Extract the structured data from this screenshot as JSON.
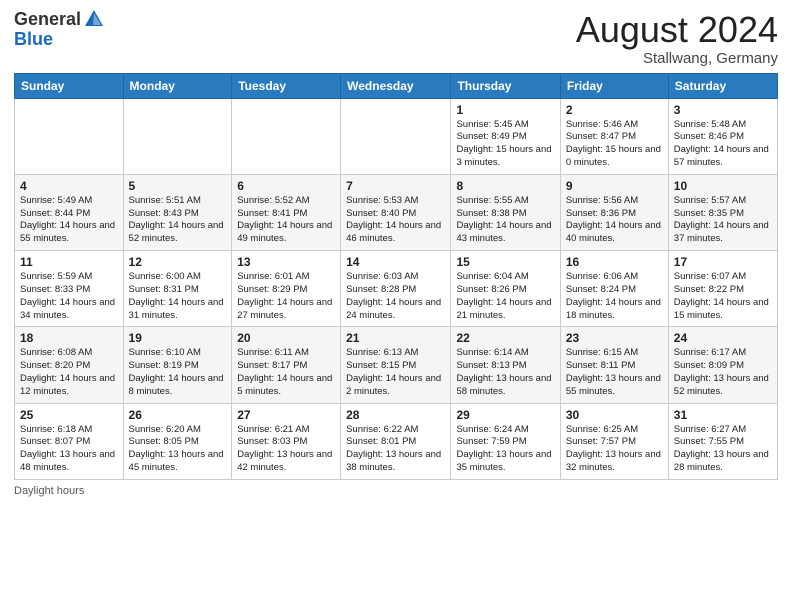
{
  "header": {
    "logo_general": "General",
    "logo_blue": "Blue",
    "month_year": "August 2024",
    "location": "Stallwang, Germany"
  },
  "days_of_week": [
    "Sunday",
    "Monday",
    "Tuesday",
    "Wednesday",
    "Thursday",
    "Friday",
    "Saturday"
  ],
  "weeks": [
    [
      {
        "day": "",
        "info": ""
      },
      {
        "day": "",
        "info": ""
      },
      {
        "day": "",
        "info": ""
      },
      {
        "day": "",
        "info": ""
      },
      {
        "day": "1",
        "info": "Sunrise: 5:45 AM\nSunset: 8:49 PM\nDaylight: 15 hours and 3 minutes."
      },
      {
        "day": "2",
        "info": "Sunrise: 5:46 AM\nSunset: 8:47 PM\nDaylight: 15 hours and 0 minutes."
      },
      {
        "day": "3",
        "info": "Sunrise: 5:48 AM\nSunset: 8:46 PM\nDaylight: 14 hours and 57 minutes."
      }
    ],
    [
      {
        "day": "4",
        "info": "Sunrise: 5:49 AM\nSunset: 8:44 PM\nDaylight: 14 hours and 55 minutes."
      },
      {
        "day": "5",
        "info": "Sunrise: 5:51 AM\nSunset: 8:43 PM\nDaylight: 14 hours and 52 minutes."
      },
      {
        "day": "6",
        "info": "Sunrise: 5:52 AM\nSunset: 8:41 PM\nDaylight: 14 hours and 49 minutes."
      },
      {
        "day": "7",
        "info": "Sunrise: 5:53 AM\nSunset: 8:40 PM\nDaylight: 14 hours and 46 minutes."
      },
      {
        "day": "8",
        "info": "Sunrise: 5:55 AM\nSunset: 8:38 PM\nDaylight: 14 hours and 43 minutes."
      },
      {
        "day": "9",
        "info": "Sunrise: 5:56 AM\nSunset: 8:36 PM\nDaylight: 14 hours and 40 minutes."
      },
      {
        "day": "10",
        "info": "Sunrise: 5:57 AM\nSunset: 8:35 PM\nDaylight: 14 hours and 37 minutes."
      }
    ],
    [
      {
        "day": "11",
        "info": "Sunrise: 5:59 AM\nSunset: 8:33 PM\nDaylight: 14 hours and 34 minutes."
      },
      {
        "day": "12",
        "info": "Sunrise: 6:00 AM\nSunset: 8:31 PM\nDaylight: 14 hours and 31 minutes."
      },
      {
        "day": "13",
        "info": "Sunrise: 6:01 AM\nSunset: 8:29 PM\nDaylight: 14 hours and 27 minutes."
      },
      {
        "day": "14",
        "info": "Sunrise: 6:03 AM\nSunset: 8:28 PM\nDaylight: 14 hours and 24 minutes."
      },
      {
        "day": "15",
        "info": "Sunrise: 6:04 AM\nSunset: 8:26 PM\nDaylight: 14 hours and 21 minutes."
      },
      {
        "day": "16",
        "info": "Sunrise: 6:06 AM\nSunset: 8:24 PM\nDaylight: 14 hours and 18 minutes."
      },
      {
        "day": "17",
        "info": "Sunrise: 6:07 AM\nSunset: 8:22 PM\nDaylight: 14 hours and 15 minutes."
      }
    ],
    [
      {
        "day": "18",
        "info": "Sunrise: 6:08 AM\nSunset: 8:20 PM\nDaylight: 14 hours and 12 minutes."
      },
      {
        "day": "19",
        "info": "Sunrise: 6:10 AM\nSunset: 8:19 PM\nDaylight: 14 hours and 8 minutes."
      },
      {
        "day": "20",
        "info": "Sunrise: 6:11 AM\nSunset: 8:17 PM\nDaylight: 14 hours and 5 minutes."
      },
      {
        "day": "21",
        "info": "Sunrise: 6:13 AM\nSunset: 8:15 PM\nDaylight: 14 hours and 2 minutes."
      },
      {
        "day": "22",
        "info": "Sunrise: 6:14 AM\nSunset: 8:13 PM\nDaylight: 13 hours and 58 minutes."
      },
      {
        "day": "23",
        "info": "Sunrise: 6:15 AM\nSunset: 8:11 PM\nDaylight: 13 hours and 55 minutes."
      },
      {
        "day": "24",
        "info": "Sunrise: 6:17 AM\nSunset: 8:09 PM\nDaylight: 13 hours and 52 minutes."
      }
    ],
    [
      {
        "day": "25",
        "info": "Sunrise: 6:18 AM\nSunset: 8:07 PM\nDaylight: 13 hours and 48 minutes."
      },
      {
        "day": "26",
        "info": "Sunrise: 6:20 AM\nSunset: 8:05 PM\nDaylight: 13 hours and 45 minutes."
      },
      {
        "day": "27",
        "info": "Sunrise: 6:21 AM\nSunset: 8:03 PM\nDaylight: 13 hours and 42 minutes."
      },
      {
        "day": "28",
        "info": "Sunrise: 6:22 AM\nSunset: 8:01 PM\nDaylight: 13 hours and 38 minutes."
      },
      {
        "day": "29",
        "info": "Sunrise: 6:24 AM\nSunset: 7:59 PM\nDaylight: 13 hours and 35 minutes."
      },
      {
        "day": "30",
        "info": "Sunrise: 6:25 AM\nSunset: 7:57 PM\nDaylight: 13 hours and 32 minutes."
      },
      {
        "day": "31",
        "info": "Sunrise: 6:27 AM\nSunset: 7:55 PM\nDaylight: 13 hours and 28 minutes."
      }
    ]
  ],
  "footer": {
    "note": "Daylight hours"
  }
}
